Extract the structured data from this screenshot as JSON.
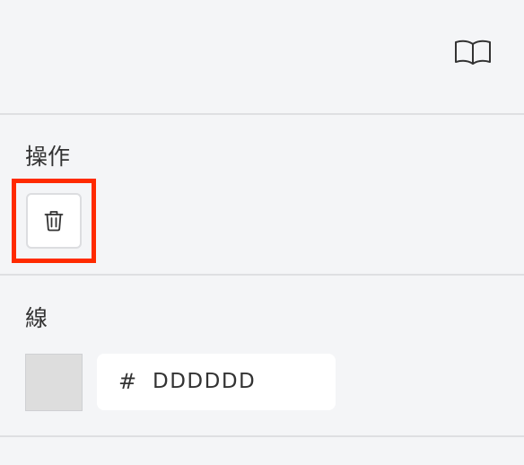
{
  "header": {
    "book_icon": "book-open-icon"
  },
  "operations": {
    "title": "操作",
    "delete_icon": "trash-icon",
    "highlight_color": "#ff2a00"
  },
  "stroke": {
    "title": "線",
    "swatch_color": "#DDDDDD",
    "hex_prefix": "#",
    "hex_value": "DDDDDD"
  }
}
